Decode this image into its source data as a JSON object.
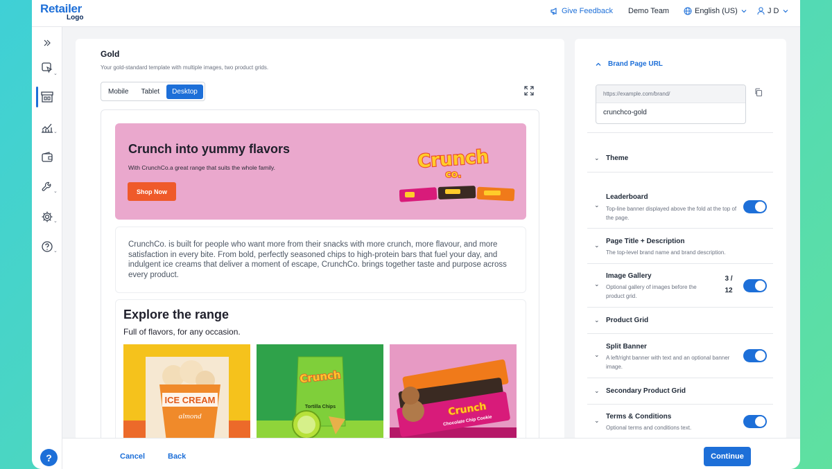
{
  "topbar": {
    "logo_line1": "Retailer",
    "logo_line2": "Logo",
    "feedback": "Give Feedback",
    "team": "Demo Team",
    "language": "English (US)",
    "user": "J D"
  },
  "editor": {
    "title": "Gold",
    "subtitle": "Your gold-standard template with multiple images, two product grids.",
    "views": [
      "Mobile",
      "Tablet",
      "Desktop"
    ],
    "active_view": "Desktop"
  },
  "preview": {
    "hero": {
      "title": "Crunch into yummy flavors",
      "desc": "With CrunchCo.a great range that suits the whole family.",
      "button": "Shop Now",
      "logo_word1": "Crunch",
      "logo_word2": "co."
    },
    "description": "CrunchCo. is built for people who want more from their snacks with more crunch, more flavour, and more satisfaction in every bite. From bold, perfectly seasoned chips to high-protein bars that fuel your day, and indulgent ice creams that deliver a moment of escape, CrunchCo. brings together taste and purpose across every product.",
    "range": {
      "title": "Explore the range",
      "subtitle": "Full of flavors, for any occasion.",
      "tiles": [
        {
          "label": "ICE CREAM",
          "sub": "almond"
        },
        {
          "label": "Crunch",
          "sub": "Tortilla Chips"
        },
        {
          "label": "Crunch",
          "sub": "Chocolate Chip Cookie"
        }
      ]
    }
  },
  "footer": {
    "cancel": "Cancel",
    "back": "Back",
    "continue": "Continue"
  },
  "settings": {
    "brand_url_label": "Brand Page URL",
    "url_prefix": "https://example.com/brand/",
    "url_value": "crunchco-gold",
    "theme_label": "Theme",
    "sections": [
      {
        "label": "Leaderboard",
        "desc": "Top-line banner displayed above the fold at the top of the page.",
        "toggle": true
      },
      {
        "label": "Page Title + Description",
        "desc": "The top-level brand name and brand description.",
        "toggle": false
      },
      {
        "label": "Image Gallery",
        "desc": "Optional gallery of images before the product grid.",
        "toggle": true,
        "count": "3 /",
        "count_total": "12"
      },
      {
        "label": "Product Grid",
        "desc": "",
        "toggle": false
      },
      {
        "label": "Split Banner",
        "desc": "A left/right banner with text and an optional banner image.",
        "toggle": true
      },
      {
        "label": "Secondary Product Grid",
        "desc": "",
        "toggle": false
      },
      {
        "label": "Terms & Conditions",
        "desc": "Optional terms and conditions text.",
        "toggle": true
      }
    ]
  },
  "colors": {
    "accent": "#1d6fd8",
    "hero_bg": "#eaa8cd",
    "cta": "#ef5a2a"
  }
}
